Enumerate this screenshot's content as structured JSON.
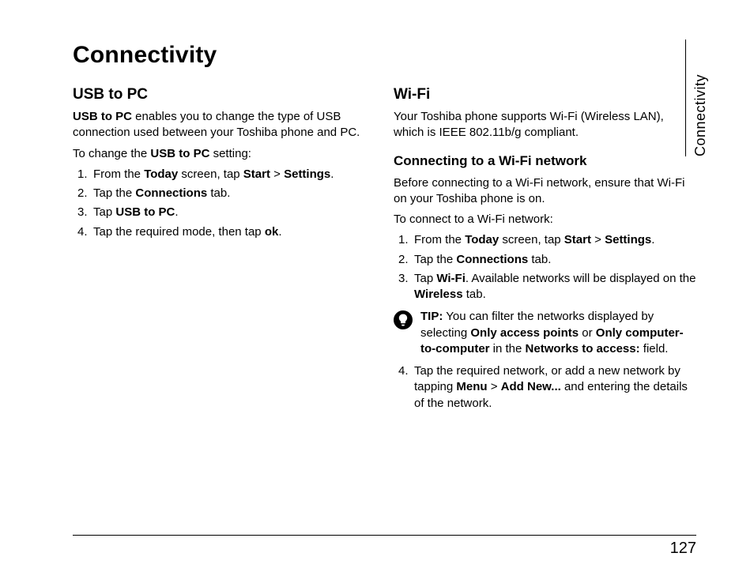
{
  "page": {
    "title": "Connectivity",
    "side_label": "Connectivity",
    "page_number": "127"
  },
  "left": {
    "heading": "USB to PC",
    "p1_a": "USB to PC",
    "p1_b": " enables you to change the type of USB connection used between your Toshiba phone and PC.",
    "p2_a": "To change the ",
    "p2_b": "USB to PC",
    "p2_c": " setting:",
    "steps": {
      "s1_a": "From the ",
      "s1_b": "Today",
      "s1_c": " screen, tap ",
      "s1_d": "Start",
      "s1_e": " > ",
      "s1_f": "Settings",
      "s1_g": ".",
      "s2_a": "Tap the ",
      "s2_b": "Connections",
      "s2_c": " tab.",
      "s3_a": "Tap ",
      "s3_b": "USB to PC",
      "s3_c": ".",
      "s4_a": "Tap the required mode, then tap ",
      "s4_b": "ok",
      "s4_c": "."
    }
  },
  "right": {
    "heading": "Wi-Fi",
    "p1": "Your Toshiba phone supports Wi-Fi (Wireless LAN), which is IEEE 802.11b/g compliant.",
    "sub_heading": "Connecting to a Wi-Fi network",
    "p2": "Before connecting to a Wi-Fi network, ensure that Wi-Fi on your Toshiba phone is on.",
    "p3": "To connect to a Wi-Fi network:",
    "steps": {
      "s1_a": "From the ",
      "s1_b": "Today",
      "s1_c": " screen, tap ",
      "s1_d": "Start",
      "s1_e": " > ",
      "s1_f": "Settings",
      "s1_g": ".",
      "s2_a": "Tap the ",
      "s2_b": "Connections",
      "s2_c": " tab.",
      "s3_a": "Tap ",
      "s3_b": "Wi-Fi",
      "s3_c": ". Available networks will be displayed on the ",
      "s3_d": "Wireless",
      "s3_e": " tab.",
      "s4_a": "Tap the required network, or add a new network by tapping ",
      "s4_b": "Menu",
      "s4_c": " > ",
      "s4_d": "Add New...",
      "s4_e": " and entering the details of the network."
    },
    "tip": {
      "label": "TIP:",
      "t1": " You can filter the networks displayed by selecting ",
      "t2": "Only access points",
      "t3": " or ",
      "t4": "Only computer-to-computer",
      "t5": " in the ",
      "t6": "Networks to access:",
      "t7": " field."
    }
  }
}
